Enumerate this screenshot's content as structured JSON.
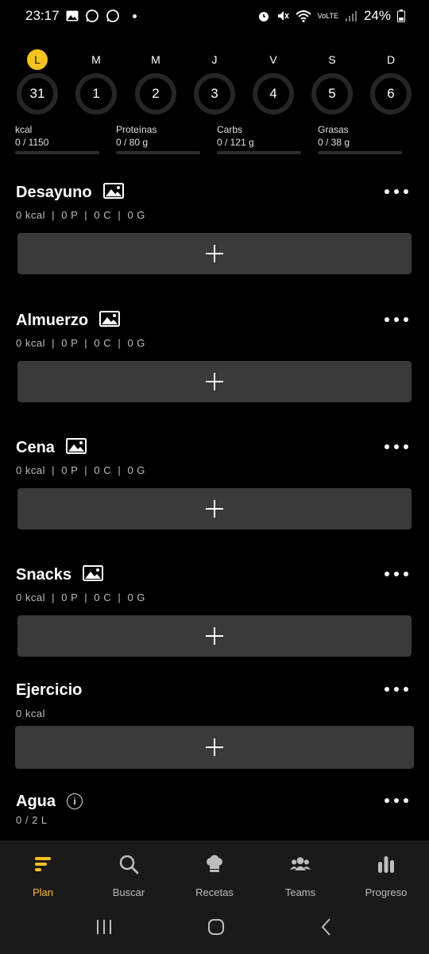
{
  "status_bar": {
    "time": "23:17",
    "battery": "24%",
    "network": "VoLTE"
  },
  "week": {
    "days": [
      {
        "letter": "L",
        "number": "31",
        "active": true
      },
      {
        "letter": "M",
        "number": "1"
      },
      {
        "letter": "M",
        "number": "2"
      },
      {
        "letter": "J",
        "number": "3"
      },
      {
        "letter": "V",
        "number": "4"
      },
      {
        "letter": "S",
        "number": "5"
      },
      {
        "letter": "D",
        "number": "6"
      }
    ]
  },
  "macros": [
    {
      "label": "kcal",
      "value": "0 / 1150",
      "progress": 0
    },
    {
      "label": "Proteínas",
      "value": "0 / 80 g",
      "progress": 0
    },
    {
      "label": "Carbs",
      "value": "0 / 121 g",
      "progress": 0
    },
    {
      "label": "Grasas",
      "value": "0 / 38 g",
      "progress": 0
    }
  ],
  "meals": [
    {
      "title": "Desayuno",
      "summary": "0 kcal  |  0 P  |  0 C  |  0 G"
    },
    {
      "title": "Almuerzo",
      "summary": "0 kcal  |  0 P  |  0 C  |  0 G"
    },
    {
      "title": "Cena",
      "summary": "0 kcal  |  0 P  |  0 C  |  0 G"
    },
    {
      "title": "Snacks",
      "summary": "0 kcal  |  0 P  |  0 C  |  0 G"
    }
  ],
  "exercise": {
    "title": "Ejercicio",
    "summary": "0 kcal"
  },
  "water": {
    "title": "Agua",
    "summary": "0 / 2 L"
  },
  "bottom_nav": [
    {
      "label": "Plan",
      "icon": "plan-icon",
      "active": true
    },
    {
      "label": "Buscar",
      "icon": "search-icon"
    },
    {
      "label": "Recetas",
      "icon": "chef-hat-icon"
    },
    {
      "label": "Teams",
      "icon": "team-icon"
    },
    {
      "label": "Progreso",
      "icon": "bar-chart-icon"
    }
  ],
  "colors": {
    "accent": "#f7c21b",
    "background": "#000000",
    "card": "#3a3a3a",
    "nav": "#1a1a1a"
  }
}
